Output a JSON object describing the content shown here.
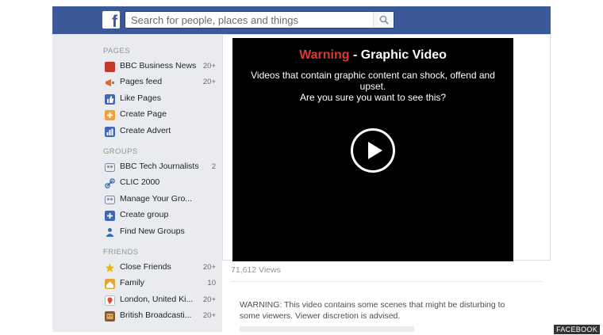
{
  "header": {
    "logo_letter": "f",
    "search_placeholder": "Search for people, places and things"
  },
  "sidebar": {
    "sections": [
      {
        "title": "PAGES",
        "items": [
          {
            "label": "BBC Business News",
            "count": "20+",
            "icon": "news-icon"
          },
          {
            "label": "Pages feed",
            "count": "20+",
            "icon": "megaphone-icon"
          },
          {
            "label": "Like Pages",
            "count": "",
            "icon": "thumbs-up-icon"
          },
          {
            "label": "Create Page",
            "count": "",
            "icon": "create-page-icon"
          },
          {
            "label": "Create Advert",
            "count": "",
            "icon": "chart-icon"
          }
        ]
      },
      {
        "title": "GROUPS",
        "items": [
          {
            "label": "BBC Tech Journalists",
            "count": "2",
            "icon": "group-icon"
          },
          {
            "label": "CLIC 2000",
            "count": "",
            "icon": "link-icon"
          },
          {
            "label": "Manage Your Gro...",
            "count": "",
            "icon": "group-icon"
          },
          {
            "label": "Create group",
            "count": "",
            "icon": "create-group-icon"
          },
          {
            "label": "Find New Groups",
            "count": "",
            "icon": "find-groups-icon"
          }
        ]
      },
      {
        "title": "FRIENDS",
        "items": [
          {
            "label": "Close Friends",
            "count": "20+",
            "icon": "star-icon"
          },
          {
            "label": "Family",
            "count": "10",
            "icon": "family-icon"
          },
          {
            "label": "London, United Ki...",
            "count": "20+",
            "icon": "location-icon"
          },
          {
            "label": "British Broadcasti...",
            "count": "20+",
            "icon": "building-icon"
          }
        ]
      }
    ]
  },
  "video": {
    "warning_word": "Warning",
    "warning_rest": " - Graphic Video",
    "message_line1": "Videos that contain graphic content can shock, offend and upset.",
    "message_line2": "Are you sure you want to see this?",
    "views": "71,612 Views"
  },
  "post": {
    "text": "WARNING: This video contains some scenes that might be disturbing to some viewers. Viewer discretion is advised."
  },
  "credit": "FACEBOOK",
  "colors": {
    "brand": "#3b5998",
    "warning_red": "#e0382a",
    "sidebar_bg": "#e9ebee"
  }
}
